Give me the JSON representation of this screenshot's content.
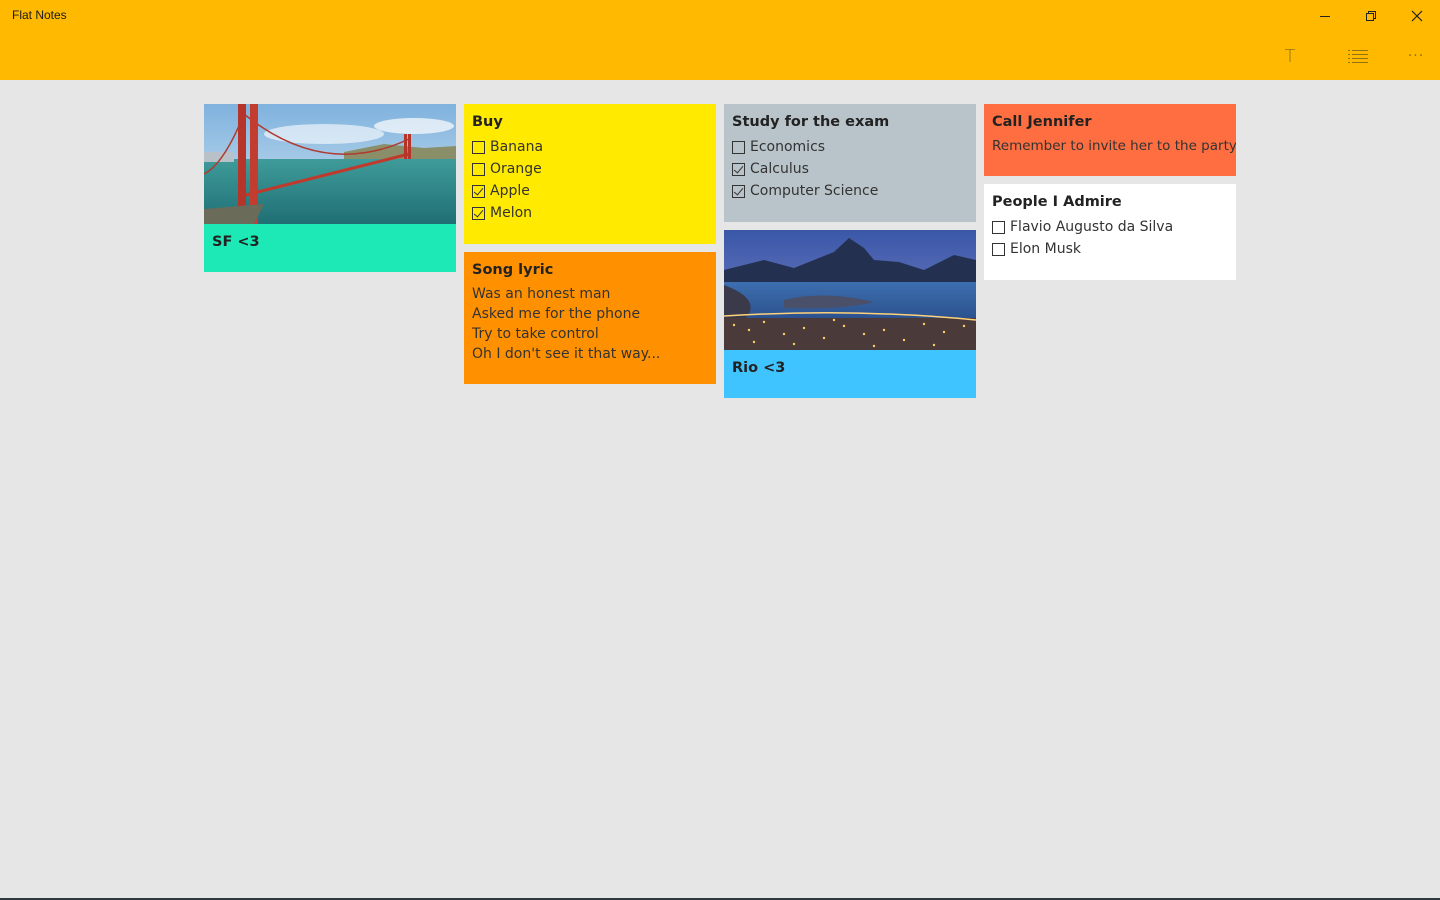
{
  "app": {
    "title": "Flat Notes"
  },
  "window_controls": {
    "minimize": "minimize-icon",
    "restore": "restore-icon",
    "close": "close-icon"
  },
  "toolbar": {
    "text_icon": "T",
    "list_icon": "list-icon",
    "more_icon": "···"
  },
  "notes": {
    "sf": {
      "title": "SF <3",
      "color": "#1de9b6",
      "image": "golden-gate-bridge-photo"
    },
    "buy": {
      "title": "Buy",
      "color": "#ffea00",
      "items": [
        {
          "label": "Banana",
          "checked": false
        },
        {
          "label": "Orange",
          "checked": false
        },
        {
          "label": "Apple",
          "checked": true
        },
        {
          "label": "Melon",
          "checked": true
        }
      ]
    },
    "song": {
      "title": "Song lyric",
      "color": "#ff9100",
      "lines": [
        "Was an honest man",
        "Asked me for the phone",
        "Try to take control",
        "Oh I don't see it that way..."
      ]
    },
    "study": {
      "title": "Study for the exam",
      "color": "#b9c4ca",
      "items": [
        {
          "label": "Economics",
          "checked": false
        },
        {
          "label": "Calculus",
          "checked": true
        },
        {
          "label": "Computer Science",
          "checked": true
        }
      ]
    },
    "rio": {
      "title": "Rio <3",
      "color": "#40c4ff",
      "image": "rio-de-janeiro-photo"
    },
    "jennifer": {
      "title": "Call Jennifer",
      "color": "#ff6e40",
      "text": "Remember to invite her to the party"
    },
    "people": {
      "title": "People I Admire",
      "color": "#ffffff",
      "items": [
        {
          "label": "Flavio Augusto da Silva",
          "checked": false
        },
        {
          "label": "Elon Musk",
          "checked": false
        }
      ]
    }
  }
}
